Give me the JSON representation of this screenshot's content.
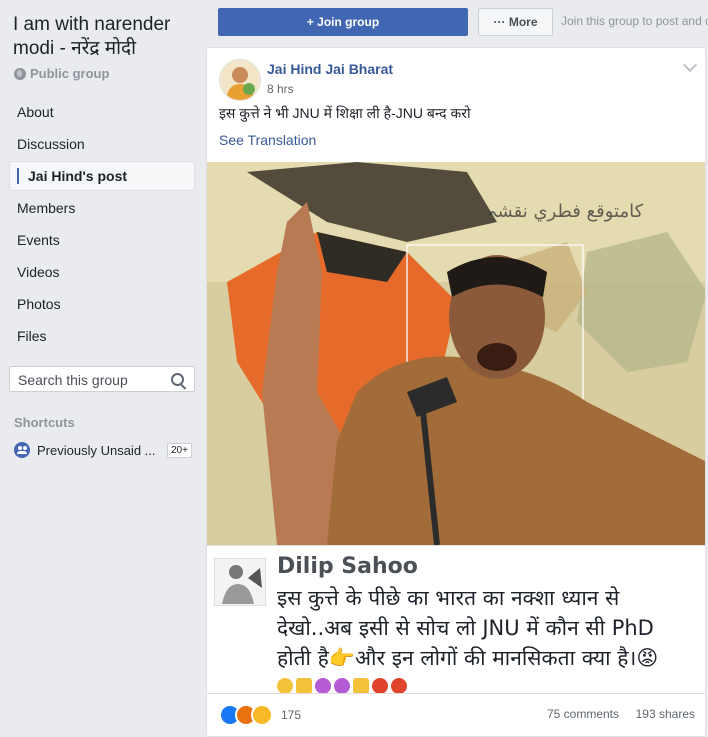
{
  "group": {
    "title": "I am with narender modi - नरेंद्र मोदी",
    "type": "Public group"
  },
  "nav": {
    "items": [
      {
        "label": "About"
      },
      {
        "label": "Discussion"
      },
      {
        "label": "Jai Hind's post",
        "active": true
      },
      {
        "label": "Members"
      },
      {
        "label": "Events"
      },
      {
        "label": "Videos"
      },
      {
        "label": "Photos"
      },
      {
        "label": "Files"
      }
    ]
  },
  "search": {
    "placeholder": "Search this group"
  },
  "shortcuts": {
    "title": "Shortcuts",
    "items": [
      {
        "label": "Previously Unsaid ...",
        "badge": "20+"
      }
    ]
  },
  "topbar": {
    "join_label": "+ Join group",
    "more_label": "··· More",
    "hint": "Join this group to post and c"
  },
  "post": {
    "author": "Jai Hind Jai Bharat",
    "time": "8 hrs",
    "text": "इस कुत्ते ने भी JNU में शिक्षा ली है-JNU बन्द करो",
    "see_translation": "See Translation",
    "image_caption": {
      "name": "Dilip Sahoo",
      "line1": "इस कुत्ते के पीछे का भारत का नक्शा ध्यान से",
      "line2": "देखो..अब इसी से सोच लो JNU में कौन सी PhD",
      "line3": "होती है👉और इन लोगों की मानसिकता क्या है।😡"
    },
    "reactions_count": "175",
    "comments": "75 comments",
    "shares": "193 shares"
  },
  "colors": {
    "accent": "#4267b2",
    "link": "#385898",
    "background": "#e9ebee"
  }
}
